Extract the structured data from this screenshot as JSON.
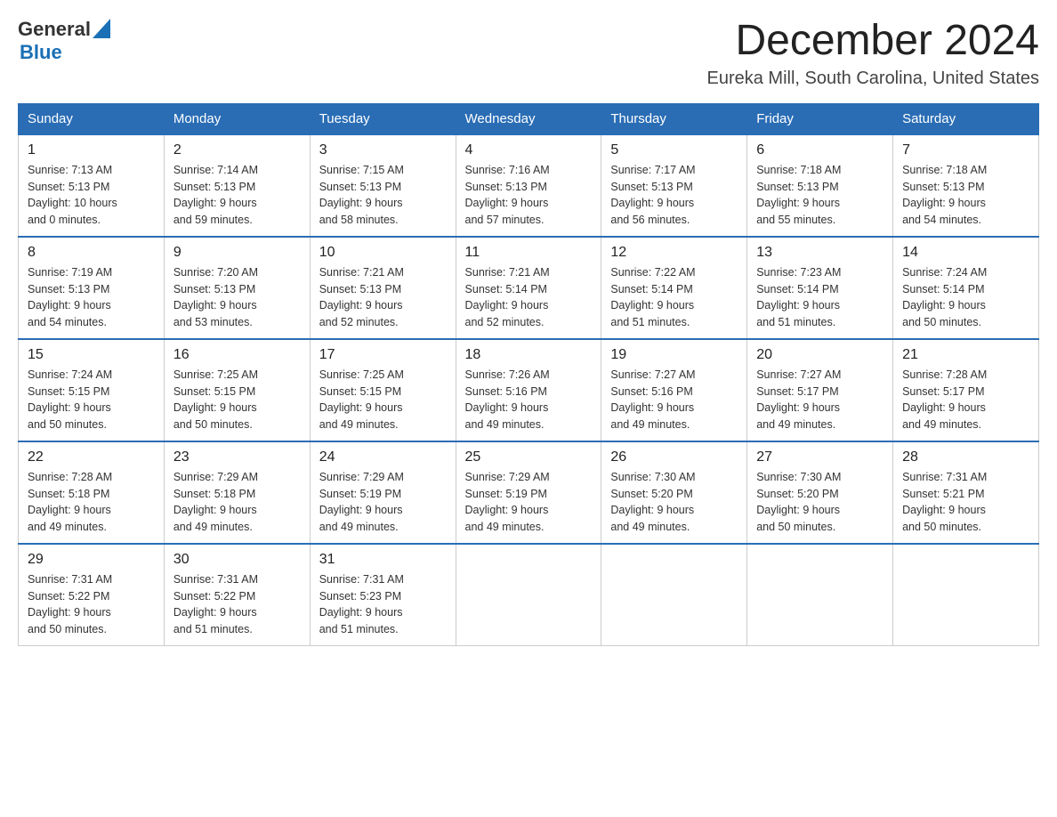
{
  "header": {
    "logo": {
      "general": "General",
      "blue": "Blue"
    },
    "title": "December 2024",
    "location": "Eureka Mill, South Carolina, United States"
  },
  "weekdays": [
    "Sunday",
    "Monday",
    "Tuesday",
    "Wednesday",
    "Thursday",
    "Friday",
    "Saturday"
  ],
  "weeks": [
    [
      {
        "day": "1",
        "sunrise": "7:13 AM",
        "sunset": "5:13 PM",
        "daylight": "10 hours and 0 minutes."
      },
      {
        "day": "2",
        "sunrise": "7:14 AM",
        "sunset": "5:13 PM",
        "daylight": "9 hours and 59 minutes."
      },
      {
        "day": "3",
        "sunrise": "7:15 AM",
        "sunset": "5:13 PM",
        "daylight": "9 hours and 58 minutes."
      },
      {
        "day": "4",
        "sunrise": "7:16 AM",
        "sunset": "5:13 PM",
        "daylight": "9 hours and 57 minutes."
      },
      {
        "day": "5",
        "sunrise": "7:17 AM",
        "sunset": "5:13 PM",
        "daylight": "9 hours and 56 minutes."
      },
      {
        "day": "6",
        "sunrise": "7:18 AM",
        "sunset": "5:13 PM",
        "daylight": "9 hours and 55 minutes."
      },
      {
        "day": "7",
        "sunrise": "7:18 AM",
        "sunset": "5:13 PM",
        "daylight": "9 hours and 54 minutes."
      }
    ],
    [
      {
        "day": "8",
        "sunrise": "7:19 AM",
        "sunset": "5:13 PM",
        "daylight": "9 hours and 54 minutes."
      },
      {
        "day": "9",
        "sunrise": "7:20 AM",
        "sunset": "5:13 PM",
        "daylight": "9 hours and 53 minutes."
      },
      {
        "day": "10",
        "sunrise": "7:21 AM",
        "sunset": "5:13 PM",
        "daylight": "9 hours and 52 minutes."
      },
      {
        "day": "11",
        "sunrise": "7:21 AM",
        "sunset": "5:14 PM",
        "daylight": "9 hours and 52 minutes."
      },
      {
        "day": "12",
        "sunrise": "7:22 AM",
        "sunset": "5:14 PM",
        "daylight": "9 hours and 51 minutes."
      },
      {
        "day": "13",
        "sunrise": "7:23 AM",
        "sunset": "5:14 PM",
        "daylight": "9 hours and 51 minutes."
      },
      {
        "day": "14",
        "sunrise": "7:24 AM",
        "sunset": "5:14 PM",
        "daylight": "9 hours and 50 minutes."
      }
    ],
    [
      {
        "day": "15",
        "sunrise": "7:24 AM",
        "sunset": "5:15 PM",
        "daylight": "9 hours and 50 minutes."
      },
      {
        "day": "16",
        "sunrise": "7:25 AM",
        "sunset": "5:15 PM",
        "daylight": "9 hours and 50 minutes."
      },
      {
        "day": "17",
        "sunrise": "7:25 AM",
        "sunset": "5:15 PM",
        "daylight": "9 hours and 49 minutes."
      },
      {
        "day": "18",
        "sunrise": "7:26 AM",
        "sunset": "5:16 PM",
        "daylight": "9 hours and 49 minutes."
      },
      {
        "day": "19",
        "sunrise": "7:27 AM",
        "sunset": "5:16 PM",
        "daylight": "9 hours and 49 minutes."
      },
      {
        "day": "20",
        "sunrise": "7:27 AM",
        "sunset": "5:17 PM",
        "daylight": "9 hours and 49 minutes."
      },
      {
        "day": "21",
        "sunrise": "7:28 AM",
        "sunset": "5:17 PM",
        "daylight": "9 hours and 49 minutes."
      }
    ],
    [
      {
        "day": "22",
        "sunrise": "7:28 AM",
        "sunset": "5:18 PM",
        "daylight": "9 hours and 49 minutes."
      },
      {
        "day": "23",
        "sunrise": "7:29 AM",
        "sunset": "5:18 PM",
        "daylight": "9 hours and 49 minutes."
      },
      {
        "day": "24",
        "sunrise": "7:29 AM",
        "sunset": "5:19 PM",
        "daylight": "9 hours and 49 minutes."
      },
      {
        "day": "25",
        "sunrise": "7:29 AM",
        "sunset": "5:19 PM",
        "daylight": "9 hours and 49 minutes."
      },
      {
        "day": "26",
        "sunrise": "7:30 AM",
        "sunset": "5:20 PM",
        "daylight": "9 hours and 49 minutes."
      },
      {
        "day": "27",
        "sunrise": "7:30 AM",
        "sunset": "5:20 PM",
        "daylight": "9 hours and 50 minutes."
      },
      {
        "day": "28",
        "sunrise": "7:31 AM",
        "sunset": "5:21 PM",
        "daylight": "9 hours and 50 minutes."
      }
    ],
    [
      {
        "day": "29",
        "sunrise": "7:31 AM",
        "sunset": "5:22 PM",
        "daylight": "9 hours and 50 minutes."
      },
      {
        "day": "30",
        "sunrise": "7:31 AM",
        "sunset": "5:22 PM",
        "daylight": "9 hours and 51 minutes."
      },
      {
        "day": "31",
        "sunrise": "7:31 AM",
        "sunset": "5:23 PM",
        "daylight": "9 hours and 51 minutes."
      },
      null,
      null,
      null,
      null
    ]
  ],
  "labels": {
    "sunrise": "Sunrise:",
    "sunset": "Sunset:",
    "daylight": "Daylight:"
  }
}
